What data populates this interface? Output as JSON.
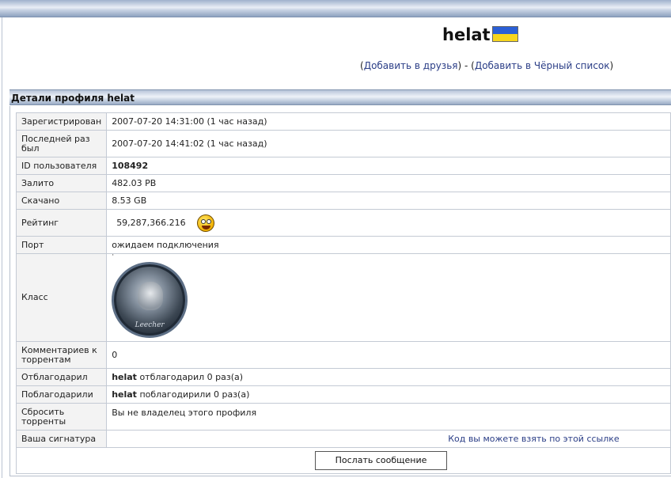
{
  "header": {
    "username": "helat",
    "flag_icon": "ukraine-flag-icon",
    "links_prefix": "(",
    "add_friend": "Добавить в друзья",
    "links_sep": ") - (",
    "add_blacklist": "Добавить в Чёрный список",
    "links_suffix": ")"
  },
  "section": {
    "title": "Детали профиля helat"
  },
  "rows": {
    "registered": {
      "label": "Зарегистрирован",
      "value": "2007-07-20 14:31:00 (1 час назад)"
    },
    "last_seen": {
      "label": "Последней раз был",
      "value": "2007-07-20 14:41:02 (1 час назад)"
    },
    "user_id": {
      "label": "ID пользователя",
      "value": "108492"
    },
    "uploaded": {
      "label": "Залито",
      "value": "482.03 PB"
    },
    "downloaded": {
      "label": "Скачано",
      "value": "8.53 GB"
    },
    "rating": {
      "label": "Рейтинг",
      "value": "59,287,366.216",
      "icon": "grinning-smiley-icon"
    },
    "port": {
      "label": "Порт",
      "value": "ожидаем подключения"
    },
    "class": {
      "label": "Класс",
      "marker": "·",
      "avatar_text": "Leecher"
    },
    "torrent_comments": {
      "label": "Комментариев к торрентам",
      "value": "0"
    },
    "thanked": {
      "label": "Отблагодарил",
      "user": "helat",
      "value": "отблагодарил 0 раз(а)"
    },
    "thanked_by": {
      "label": "Поблагодарили",
      "user": "helat",
      "value": "поблагодирили 0 раз(а)"
    },
    "reset_torrents": {
      "label": "Сбросить торренты",
      "value": "Вы не владелец этого профиля"
    },
    "signature": {
      "label": "Ваша сигнатура",
      "value": "Код вы можете взять по этой ссылке"
    }
  },
  "actions": {
    "send_message": "Послать сообщение"
  },
  "colors": {
    "link": "#2a3d86",
    "label_bg": "#f3f3f3",
    "flag_blue": "#2b5fd6",
    "flag_yellow": "#f7d51d"
  }
}
